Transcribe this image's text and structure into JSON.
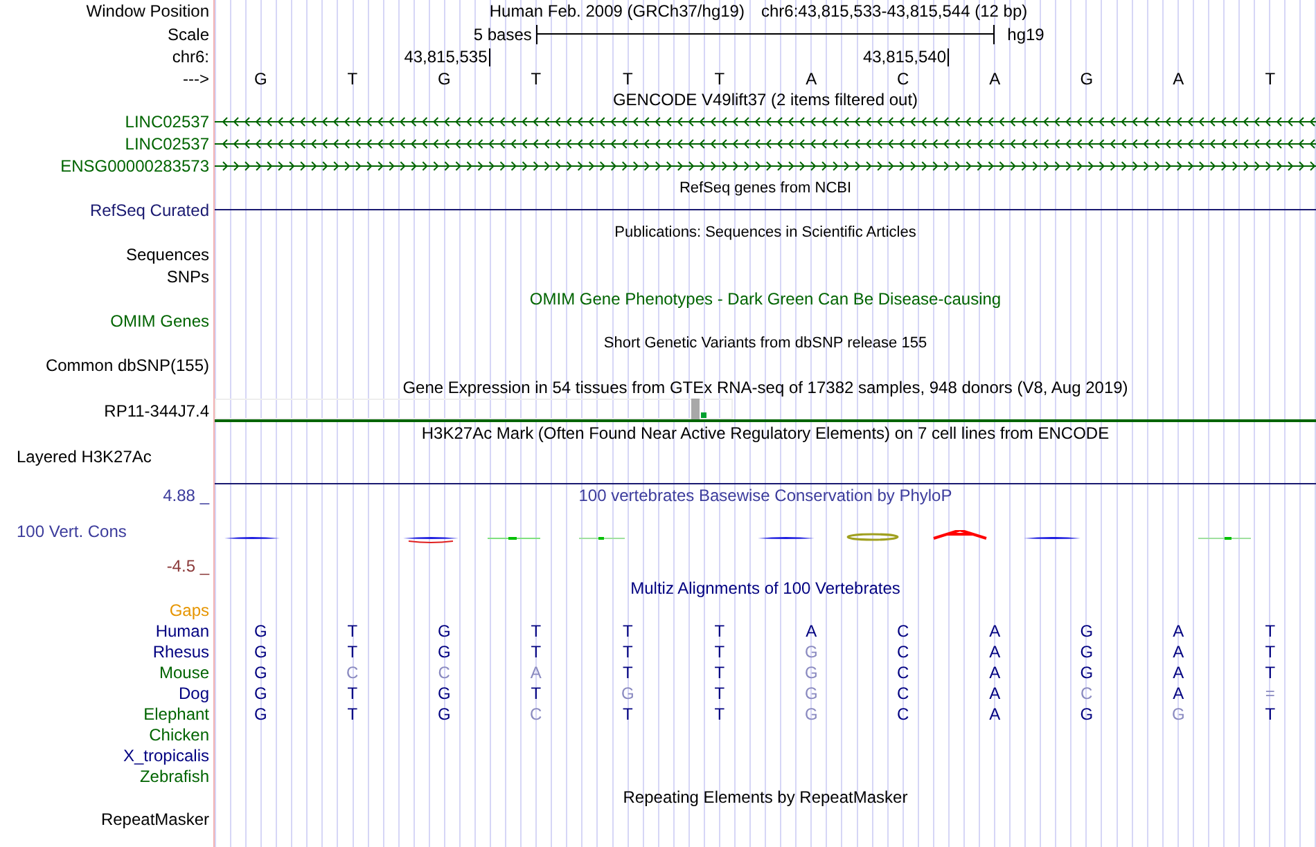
{
  "header": {
    "position_label": "Window Position",
    "assembly": "Human Feb. 2009 (GRCh37/hg19)",
    "position": "chr6:43,815,533-43,815,544 (12 bp)",
    "scale_label": "Scale",
    "scale_text": "5 bases",
    "scale_db": "hg19",
    "chrom_label": "chr6:",
    "ticks": [
      "43,815,535",
      "43,815,540"
    ],
    "strand_label": "--->",
    "bases": [
      "G",
      "T",
      "G",
      "T",
      "T",
      "T",
      "A",
      "C",
      "A",
      "G",
      "A",
      "T"
    ]
  },
  "tracks": [
    {
      "kind": "title",
      "text": "GENCODE V49lift37 (2 items filtered out)",
      "color": "#000000"
    },
    {
      "kind": "gene",
      "label": "LINC02537",
      "color": "#006400",
      "reverse_strand": true
    },
    {
      "kind": "gene",
      "label": "LINC02537",
      "color": "#006400",
      "reverse_strand": true
    },
    {
      "kind": "gene",
      "label": "ENSG00000283573",
      "color": "#006400",
      "reverse_strand": false
    },
    {
      "kind": "caption",
      "text": "RefSeq genes from NCBI",
      "color": "#000000"
    },
    {
      "kind": "line",
      "label": "RefSeq Curated",
      "color": "#191970"
    },
    {
      "kind": "caption",
      "text": "Publications: Sequences in Scientific Articles",
      "color": "#000000"
    },
    {
      "kind": "label",
      "label": "Sequences",
      "color": "#000000"
    },
    {
      "kind": "label",
      "label": "SNPs",
      "color": "#000000"
    },
    {
      "kind": "title",
      "text": "OMIM Gene Phenotypes - Dark Green Can Be Disease-causing",
      "color": "#006400"
    },
    {
      "kind": "label",
      "label": "OMIM Genes",
      "color": "#006400"
    },
    {
      "kind": "caption",
      "text": "Short Genetic Variants from dbSNP release 155",
      "color": "#000000"
    },
    {
      "kind": "label",
      "label": "Common dbSNP(155)",
      "color": "#000000"
    },
    {
      "kind": "title",
      "text": "Gene Expression in 54 tissues from GTEx RNA-seq of 17382 samples, 948 donors (V8, Aug 2019)",
      "color": "#000000"
    },
    {
      "kind": "expression",
      "label": "RP11-344J7.4",
      "color": "#000000"
    },
    {
      "kind": "title",
      "text": "H3K27Ac Mark (Often Found Near Active Regulatory Elements) on 7 cell lines from ENCODE",
      "color": "#000000"
    },
    {
      "kind": "layered",
      "label": "Layered H3K27Ac",
      "color": "#000000"
    },
    {
      "kind": "wiggle",
      "title": "100 vertebrates Basewise Conservation by PhyloP",
      "label": "100 Vert. Cons",
      "max": "4.88 _",
      "min": "-4.5 _",
      "color": "#3c3c9c"
    },
    {
      "kind": "title",
      "text": "Multiz Alignments of 100 Vertebrates",
      "color": "#000080"
    },
    {
      "kind": "species",
      "label": "Gaps",
      "color": "#e69500"
    },
    {
      "kind": "species",
      "label": "Human",
      "color": "#000080",
      "bases": [
        {
          "base": "G",
          "faded": false
        },
        {
          "base": "T",
          "faded": false
        },
        {
          "base": "G",
          "faded": false
        },
        {
          "base": "T",
          "faded": false
        },
        {
          "base": "T",
          "faded": false
        },
        {
          "base": "T",
          "faded": false
        },
        {
          "base": "A",
          "faded": false
        },
        {
          "base": "C",
          "faded": false
        },
        {
          "base": "A",
          "faded": false
        },
        {
          "base": "G",
          "faded": false
        },
        {
          "base": "A",
          "faded": false
        },
        {
          "base": "T",
          "faded": false
        }
      ]
    },
    {
      "kind": "species",
      "label": "Rhesus",
      "color": "#000080",
      "bases": [
        {
          "base": "G",
          "faded": false
        },
        {
          "base": "T",
          "faded": false
        },
        {
          "base": "G",
          "faded": false
        },
        {
          "base": "T",
          "faded": false
        },
        {
          "base": "T",
          "faded": false
        },
        {
          "base": "T",
          "faded": false
        },
        {
          "base": "G",
          "faded": true
        },
        {
          "base": "C",
          "faded": false
        },
        {
          "base": "A",
          "faded": false
        },
        {
          "base": "G",
          "faded": false
        },
        {
          "base": "A",
          "faded": false
        },
        {
          "base": "T",
          "faded": false
        }
      ]
    },
    {
      "kind": "species",
      "label": "Mouse",
      "color": "#006400",
      "bases": [
        {
          "base": "G",
          "faded": false
        },
        {
          "base": "C",
          "faded": true
        },
        {
          "base": "C",
          "faded": true
        },
        {
          "base": "A",
          "faded": true
        },
        {
          "base": "T",
          "faded": false
        },
        {
          "base": "T",
          "faded": false
        },
        {
          "base": "G",
          "faded": true
        },
        {
          "base": "C",
          "faded": false
        },
        {
          "base": "A",
          "faded": false
        },
        {
          "base": "G",
          "faded": false
        },
        {
          "base": "A",
          "faded": false
        },
        {
          "base": "T",
          "faded": false
        }
      ]
    },
    {
      "kind": "species",
      "label": "Dog",
      "color": "#000080",
      "bases": [
        {
          "base": "G",
          "faded": false
        },
        {
          "base": "T",
          "faded": false
        },
        {
          "base": "G",
          "faded": false
        },
        {
          "base": "T",
          "faded": false
        },
        {
          "base": "G",
          "faded": true
        },
        {
          "base": "T",
          "faded": false
        },
        {
          "base": "G",
          "faded": true
        },
        {
          "base": "C",
          "faded": false
        },
        {
          "base": "A",
          "faded": false
        },
        {
          "base": "C",
          "faded": true
        },
        {
          "base": "A",
          "faded": false
        },
        {
          "base": "=",
          "faded": true
        }
      ]
    },
    {
      "kind": "species",
      "label": "Elephant",
      "color": "#006400",
      "bases": [
        {
          "base": "G",
          "faded": false
        },
        {
          "base": "T",
          "faded": false
        },
        {
          "base": "G",
          "faded": false
        },
        {
          "base": "C",
          "faded": true
        },
        {
          "base": "T",
          "faded": false
        },
        {
          "base": "T",
          "faded": false
        },
        {
          "base": "G",
          "faded": true
        },
        {
          "base": "C",
          "faded": false
        },
        {
          "base": "A",
          "faded": false
        },
        {
          "base": "G",
          "faded": false
        },
        {
          "base": "G",
          "faded": true
        },
        {
          "base": "T",
          "faded": false
        }
      ]
    },
    {
      "kind": "species",
      "label": "Chicken",
      "color": "#006400"
    },
    {
      "kind": "species",
      "label": "X_tropicalis",
      "color": "#000080"
    },
    {
      "kind": "species",
      "label": "Zebrafish",
      "color": "#006400"
    },
    {
      "kind": "title",
      "text": "Repeating Elements by RepeatMasker",
      "color": "#000000"
    },
    {
      "kind": "label",
      "label": "RepeatMasker",
      "color": "#000000"
    }
  ]
}
